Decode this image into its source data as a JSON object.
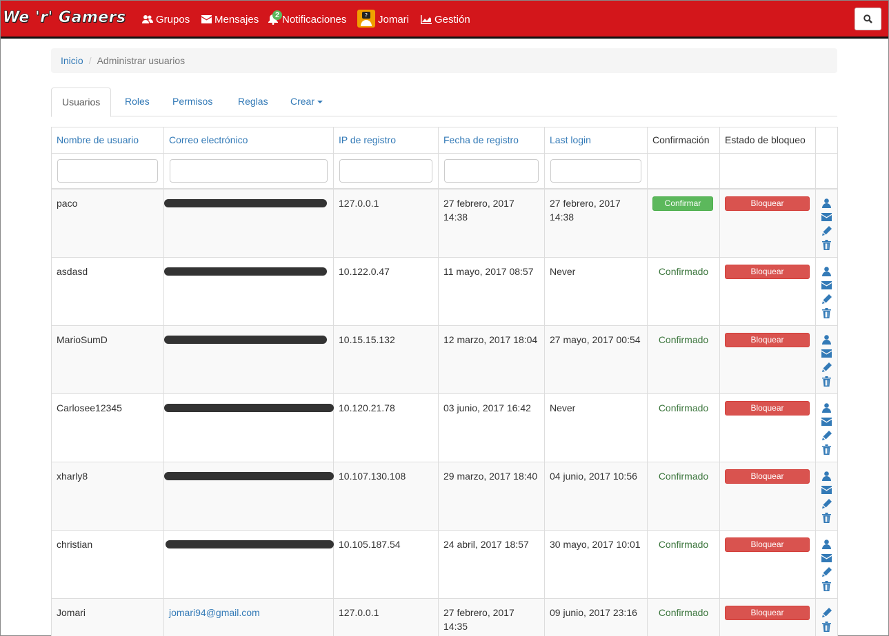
{
  "navbar": {
    "brand": "We 'r' Gamers",
    "items": [
      {
        "label": "Grupos",
        "icon": "users-icon"
      },
      {
        "label": "Mensajes",
        "icon": "envelope-icon"
      },
      {
        "label": "Notificaciones",
        "icon": "bell-icon",
        "badge": "2"
      },
      {
        "label": "Jomari",
        "icon": "avatar"
      },
      {
        "label": "Gestión",
        "icon": "chart-icon"
      }
    ],
    "search_icon": "search-icon",
    "color": "#d3161b"
  },
  "breadcrumb": {
    "home": "Inicio",
    "separator": "/",
    "current": "Administrar usuarios"
  },
  "tabs": [
    {
      "label": "Usuarios",
      "active": true
    },
    {
      "label": "Roles"
    },
    {
      "label": "Permisos"
    },
    {
      "label": "Reglas"
    },
    {
      "label": "Crear",
      "dropdown": true
    }
  ],
  "table": {
    "headers": {
      "username": "Nombre de usuario",
      "email": "Correo electrónico",
      "ip": "IP de registro",
      "date": "Fecha de registro",
      "last_login": "Last login",
      "confirmation": "Confirmación",
      "block": "Estado de bloqueo"
    },
    "rows": [
      {
        "username": "paco",
        "email": "",
        "ip": "127.0.0.1",
        "date": "27 febrero, 2017 14:38",
        "last_login": "27 febrero, 2017 14:38",
        "confirmation": "Confirmar",
        "confirmed": false,
        "block": "Bloquear",
        "actions": [
          "user-icon",
          "envelope-icon",
          "pencil-icon",
          "trash-icon"
        ]
      },
      {
        "username": "asdasd",
        "email": "",
        "ip": "10.122.0.47",
        "date": "11 mayo, 2017 08:57",
        "last_login": "Never",
        "confirmation": "Confirmado",
        "confirmed": true,
        "block": "Bloquear",
        "actions": [
          "user-icon",
          "envelope-icon",
          "pencil-icon",
          "trash-icon"
        ]
      },
      {
        "username": "MarioSumD",
        "email": "",
        "ip": "10.15.15.132",
        "date": "12 marzo, 2017 18:04",
        "last_login": "27 mayo, 2017 00:54",
        "confirmation": "Confirmado",
        "confirmed": true,
        "block": "Bloquear",
        "actions": [
          "user-icon",
          "envelope-icon",
          "pencil-icon",
          "trash-icon"
        ]
      },
      {
        "username": "Carlosee12345",
        "email": "",
        "ip": "10.120.21.78",
        "date": "03 junio, 2017 16:42",
        "last_login": "Never",
        "confirmation": "Confirmado",
        "confirmed": true,
        "block": "Bloquear",
        "actions": [
          "user-icon",
          "envelope-icon",
          "pencil-icon",
          "trash-icon"
        ]
      },
      {
        "username": "xharly8",
        "email": "",
        "ip": "10.107.130.108",
        "date": "29 marzo, 2017 18:40",
        "last_login": "04 junio, 2017 10:56",
        "confirmation": "Confirmado",
        "confirmed": true,
        "block": "Bloquear",
        "actions": [
          "user-icon",
          "envelope-icon",
          "pencil-icon",
          "trash-icon"
        ]
      },
      {
        "username": "christian",
        "email": "",
        "ip": "10.105.187.54",
        "date": "24 abril, 2017 18:57",
        "last_login": "30 mayo, 2017 10:01",
        "confirmation": "Confirmado",
        "confirmed": true,
        "block": "Bloquear",
        "actions": [
          "user-icon",
          "envelope-icon",
          "pencil-icon",
          "trash-icon"
        ]
      },
      {
        "username": "Jomari",
        "email": "jomari94@gmail.com",
        "ip": "127.0.0.1",
        "date": "27 febrero, 2017 14:35",
        "last_login": "09 junio, 2017 23:16",
        "confirmation": "Confirmado",
        "confirmed": true,
        "block": "Bloquear",
        "actions": [
          "pencil-icon",
          "trash-icon"
        ]
      }
    ]
  },
  "colors": {
    "link": "#337ab7",
    "success": "#5cb85c",
    "danger": "#d9534f",
    "confirmed_text": "#3c763d"
  }
}
